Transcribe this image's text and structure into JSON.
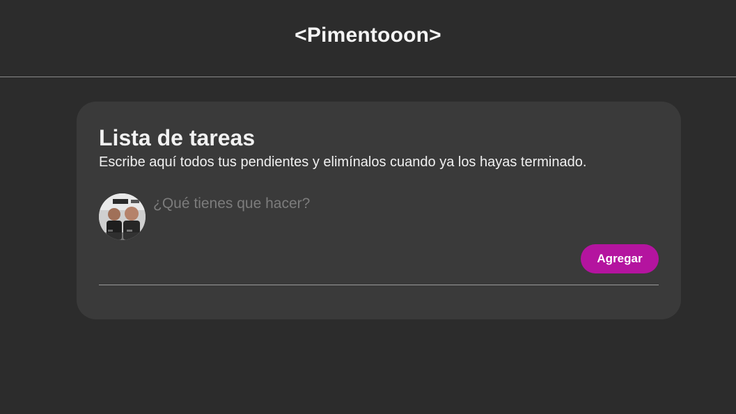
{
  "header": {
    "brand": "<Pimentooon>"
  },
  "todo": {
    "title": "Lista de tareas",
    "subtitle": "Escribe aquí todos tus pendientes y elimínalos cuando ya los hayas terminado.",
    "input": {
      "placeholder": "¿Qué tienes que hacer?",
      "value": ""
    },
    "add_label": "Agregar",
    "avatar_icon": "user-avatar-photo"
  },
  "colors": {
    "background": "#2c2c2c",
    "card": "#3a3a3a",
    "accent": "#b4149f"
  }
}
